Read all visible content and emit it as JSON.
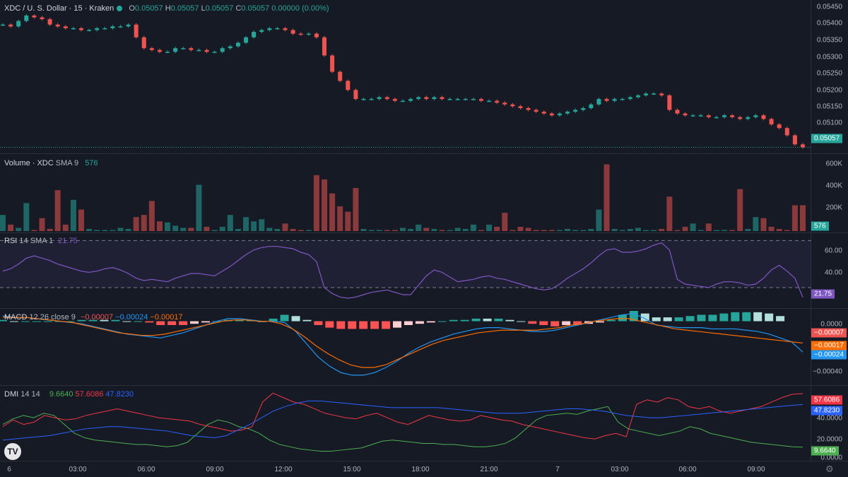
{
  "symbol": {
    "title": "XDC / U. S. Dollar · 15 · Kraken",
    "o_label": "O",
    "o_val": "0.05057",
    "h_label": "H",
    "h_val": "0.05057",
    "l_label": "L",
    "l_val": "0.05057",
    "c_label": "C",
    "c_val": "0.05057",
    "change": "0.00000 (0.00%)"
  },
  "volume_legend": {
    "label": "Volume · XDC",
    "sma": "SMA 9",
    "value": "576"
  },
  "rsi_legend": {
    "label": "RSI",
    "params": "14 SMA 1",
    "value": "21.75"
  },
  "macd_legend": {
    "label": "MACD",
    "params": "12 26 close 9",
    "hist": "−0.00007",
    "macd": "−0.00024",
    "signal": "−0.00017"
  },
  "dmi_legend": {
    "label": "DMI",
    "params": "14 14",
    "plus": "9.6640",
    "minus": "57.6086",
    "adx": "47.8230"
  },
  "price_axis": [
    "0.05450",
    "0.05400",
    "0.05350",
    "0.05300",
    "0.05250",
    "0.05200",
    "0.05150",
    "0.05100"
  ],
  "price_badge": "0.05057",
  "volume_axis": [
    "600K",
    "400K",
    "200K"
  ],
  "volume_badge": "576",
  "rsi_axis": [
    "60.00",
    "40.00"
  ],
  "rsi_badge": "21.75",
  "macd_axis": [
    "0.0000",
    "−0.00040"
  ],
  "macd_badges": [
    "−0.00007",
    "−0.00017",
    "−0.00024"
  ],
  "dmi_axis": [
    "40.0000",
    "20.0000",
    "0.0000"
  ],
  "dmi_badges": [
    "57.6086",
    "47.8230",
    "9.6640"
  ],
  "time_axis": [
    "6",
    "03:00",
    "06:00",
    "09:00",
    "12:00",
    "15:00",
    "18:00",
    "21:00",
    "7",
    "03:00",
    "06:00",
    "09:00"
  ],
  "logo": "TV",
  "icons": {
    "settings": "gear-icon"
  },
  "colors": {
    "up": "#26a69a",
    "down": "#ef5350",
    "rsi": "#7e57c2",
    "macd": "#2196f3",
    "signal": "#ff6d00",
    "plus": "#4caf50",
    "minus": "#f23645",
    "adx": "#2962ff"
  },
  "chart_data": {
    "type": "candlestick",
    "price_range": [
      0.0505,
      0.05455
    ],
    "price_close": [
      0.05395,
      0.0539,
      0.05405,
      0.0542,
      0.05415,
      0.0541,
      0.05395,
      0.0539,
      0.05385,
      0.05385,
      0.0538,
      0.0538,
      0.05385,
      0.05385,
      0.0539,
      0.0539,
      0.05395,
      0.0536,
      0.0533,
      0.05325,
      0.0532,
      0.0532,
      0.0533,
      0.0533,
      0.05325,
      0.05325,
      0.0532,
      0.0532,
      0.0533,
      0.05335,
      0.05345,
      0.0536,
      0.05375,
      0.0538,
      0.05385,
      0.05385,
      0.0538,
      0.0537,
      0.05368,
      0.0537,
      0.0536,
      0.0531,
      0.05265,
      0.0524,
      0.05215,
      0.0519,
      0.0519,
      0.0519,
      0.05195,
      0.0519,
      0.05185,
      0.05185,
      0.0519,
      0.05195,
      0.0519,
      0.05195,
      0.0519,
      0.0519,
      0.0519,
      0.0519,
      0.0519,
      0.05185,
      0.05185,
      0.0518,
      0.05175,
      0.0517,
      0.05165,
      0.0516,
      0.05155,
      0.0515,
      0.05145,
      0.0515,
      0.05155,
      0.0516,
      0.05165,
      0.05175,
      0.0519,
      0.05185,
      0.0519,
      0.0519,
      0.05195,
      0.052,
      0.05205,
      0.05205,
      0.052,
      0.0516,
      0.0515,
      0.05145,
      0.05145,
      0.05145,
      0.0514,
      0.0514,
      0.05145,
      0.0514,
      0.05135,
      0.0514,
      0.05145,
      0.05135,
      0.0512,
      0.0511,
      0.0509,
      0.05065,
      0.05057
    ],
    "volume_range_k": [
      0,
      650
    ],
    "volume_k": [
      150,
      60,
      30,
      260,
      10,
      120,
      20,
      380,
      60,
      290,
      200,
      20,
      10,
      10,
      10,
      30,
      20,
      130,
      150,
      280,
      90,
      80,
      50,
      30,
      30,
      430,
      40,
      10,
      40,
      150,
      20,
      130,
      90,
      110,
      30,
      20,
      70,
      20,
      10,
      10,
      520,
      480,
      350,
      230,
      180,
      400,
      20,
      10,
      10,
      10,
      10,
      30,
      20,
      60,
      30,
      20,
      10,
      10,
      30,
      20,
      60,
      10,
      60,
      40,
      170,
      10,
      40,
      30,
      10,
      10,
      10,
      10,
      20,
      10,
      10,
      20,
      200,
      620,
      20,
      10,
      20,
      30,
      10,
      10,
      20,
      320,
      10,
      40,
      70,
      10,
      70,
      10,
      10,
      10,
      390,
      20,
      130,
      120,
      40,
      20,
      10,
      240,
      240
    ],
    "rsi_range": [
      15,
      75
    ],
    "rsi": [
      44,
      46,
      50,
      55,
      57,
      55,
      53,
      50,
      48,
      46,
      44,
      43,
      44,
      46,
      47,
      45,
      42,
      38,
      36,
      37,
      36,
      35,
      38,
      40,
      42,
      42,
      41,
      40,
      44,
      48,
      53,
      58,
      62,
      64,
      65,
      65,
      64,
      63,
      60,
      58,
      52,
      30,
      25,
      22,
      21,
      22,
      24,
      26,
      27,
      28,
      26,
      24,
      24,
      32,
      40,
      45,
      43,
      39,
      35,
      36,
      37,
      39,
      40,
      38,
      37,
      35,
      33,
      31,
      29,
      28,
      29,
      33,
      38,
      42,
      46,
      51,
      57,
      62,
      63,
      60,
      60,
      61,
      63,
      66,
      68,
      62,
      37,
      33,
      32,
      31,
      30,
      33,
      35,
      35,
      34,
      32,
      33,
      38,
      45,
      49,
      44,
      38,
      21.75
    ],
    "macd_range": [
      -0.00047,
      8e-05
    ],
    "macd": [
      4e-05,
      3e-05,
      3e-05,
      2e-05,
      1e-05,
      0.0,
      -1e-05,
      -2e-05,
      -4e-05,
      -6e-05,
      -8e-05,
      -0.0001,
      -0.00011,
      -0.00012,
      -0.00013,
      -0.00011,
      -9e-05,
      -6e-05,
      -3e-05,
      0.0,
      2e-05,
      2e-05,
      1e-05,
      0.0,
      0.0,
      -1e-05,
      -8e-05,
      -0.00018,
      -0.00028,
      -0.00035,
      -0.0004,
      -0.00042,
      -0.00042,
      -0.0004,
      -0.00036,
      -0.00031,
      -0.00025,
      -0.0002,
      -0.00016,
      -0.00013,
      -0.0001,
      -8e-05,
      -6e-05,
      -5e-05,
      -5e-05,
      -6e-05,
      -7e-05,
      -8e-05,
      -8e-05,
      -7e-05,
      -5e-05,
      -3e-05,
      -1e-05,
      1e-05,
      3e-05,
      5e-05,
      6e-05,
      2e-05,
      -3e-05,
      -4e-05,
      -5e-05,
      -5e-05,
      -5e-05,
      -6e-05,
      -6e-05,
      -6e-05,
      -7e-05,
      -8e-05,
      -0.0001,
      -0.00013,
      -0.00016,
      -0.00024
    ],
    "signal": [
      3e-05,
      3e-05,
      3e-05,
      2e-05,
      1e-05,
      0.0,
      -1e-05,
      -3e-05,
      -5e-05,
      -7e-05,
      -9e-05,
      -0.0001,
      -0.00011,
      -0.00011,
      -0.0001,
      -8e-05,
      -6e-05,
      -4e-05,
      -2e-05,
      0.0,
      1e-05,
      1e-05,
      0.0,
      0.0,
      -2e-05,
      -6e-05,
      -0.00012,
      -0.00019,
      -0.00025,
      -0.0003,
      -0.00034,
      -0.00036,
      -0.00036,
      -0.00034,
      -0.0003,
      -0.00026,
      -0.00022,
      -0.00018,
      -0.00015,
      -0.00013,
      -0.00011,
      -9e-05,
      -8e-05,
      -7e-05,
      -7e-05,
      -7e-05,
      -7e-05,
      -6e-05,
      -5e-05,
      -3e-05,
      -2e-05,
      0.0,
      1e-05,
      2e-05,
      2e-05,
      0.0,
      -2e-05,
      -4e-05,
      -6e-05,
      -7e-05,
      -8e-05,
      -9e-05,
      -0.0001,
      -0.00011,
      -0.00012,
      -0.00013,
      -0.00014,
      -0.00015,
      -0.00016,
      -0.00017
    ],
    "dmi_range": [
      0,
      62
    ],
    "plus_di": [
      30,
      35,
      38,
      36,
      40,
      38,
      30,
      22,
      18,
      16,
      15,
      14,
      13,
      12,
      12,
      11,
      10,
      11,
      14,
      22,
      30,
      34,
      32,
      28,
      26,
      22,
      16,
      12,
      10,
      8,
      7,
      6,
      6,
      7,
      8,
      9,
      12,
      15,
      16,
      15,
      14,
      13,
      13,
      12,
      12,
      11,
      10,
      10,
      11,
      13,
      18,
      26,
      34,
      38,
      39,
      40,
      39,
      42,
      44,
      46,
      32,
      26,
      24,
      22,
      20,
      22,
      24,
      28,
      26,
      22,
      20,
      18,
      16,
      14,
      13,
      12,
      11,
      10,
      9.664
    ],
    "minus_di": [
      28,
      34,
      30,
      32,
      38,
      36,
      34,
      35,
      38,
      40,
      42,
      44,
      42,
      40,
      38,
      36,
      35,
      34,
      33,
      30,
      28,
      26,
      24,
      25,
      28,
      50,
      58,
      54,
      50,
      48,
      44,
      40,
      38,
      36,
      35,
      38,
      40,
      36,
      32,
      30,
      34,
      38,
      36,
      34,
      33,
      34,
      38,
      36,
      34,
      33,
      30,
      28,
      26,
      24,
      22,
      20,
      18,
      17,
      20,
      22,
      19,
      48,
      52,
      50,
      54,
      52,
      46,
      44,
      46,
      42,
      40,
      42,
      44,
      46,
      50,
      54,
      57,
      57.6086
    ],
    "adx": [
      16,
      17,
      18,
      19,
      20,
      22,
      24,
      26,
      27,
      28,
      28,
      27,
      26,
      25,
      24,
      22,
      20,
      19,
      18,
      20,
      25,
      30,
      36,
      42,
      46,
      49,
      51,
      51,
      50,
      49,
      48,
      47,
      46,
      45,
      45,
      45,
      45,
      45,
      44,
      43,
      42,
      41,
      40,
      40,
      40,
      41,
      42,
      43,
      44,
      44,
      43,
      42,
      40,
      38,
      37,
      36,
      36,
      37,
      38,
      39,
      40,
      41,
      42,
      43,
      44,
      45,
      46,
      47,
      47.823
    ]
  }
}
